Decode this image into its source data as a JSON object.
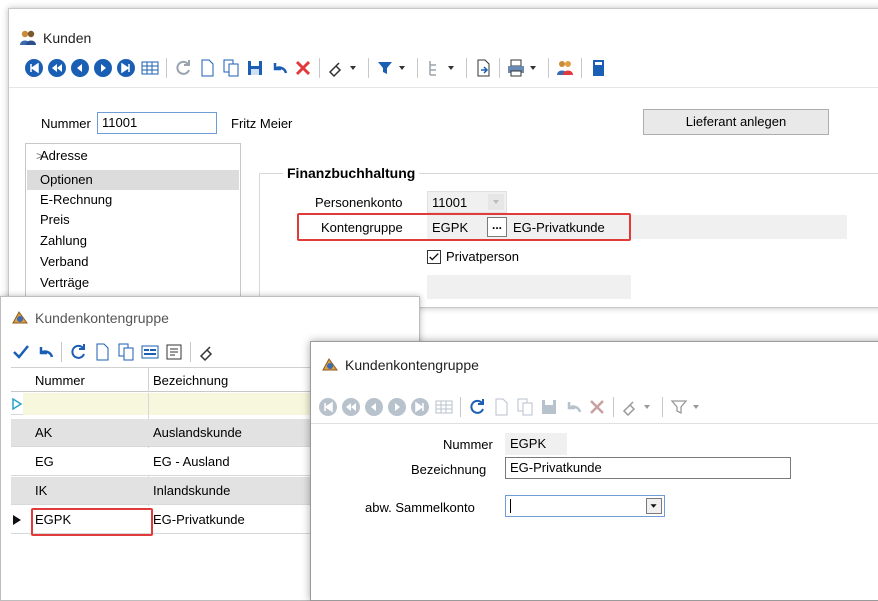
{
  "kunden": {
    "title": "Kunden",
    "nummer_label": "Nummer",
    "nummer_value": "11001",
    "name": "Fritz Meier",
    "lieferant_button": "Lieferant anlegen",
    "tree": {
      "items": [
        {
          "label": "Adresse",
          "expand": ">"
        },
        {
          "label": "Optionen"
        },
        {
          "label": "E-Rechnung"
        },
        {
          "label": "Preis"
        },
        {
          "label": "Zahlung"
        },
        {
          "label": "Verband"
        },
        {
          "label": "Verträge"
        }
      ]
    },
    "fibu": {
      "heading": "Finanzbuchhaltung",
      "personenkonto_label": "Personenkonto",
      "personenkonto_value": "11001",
      "kontengruppe_label": "Kontengruppe",
      "kontengruppe_value": "EGPK",
      "browse_label": "...",
      "kontengruppe_desc": "EG-Privatkunde",
      "privatperson_label": "Privatperson",
      "privatperson_checked": true
    }
  },
  "liste": {
    "title": "Kundenkontengruppe",
    "columns": [
      "Nummer",
      "Bezeichnung"
    ],
    "rows": [
      {
        "nummer": "AK",
        "bezeichnung": "Auslandskunde"
      },
      {
        "nummer": "EG",
        "bezeichnung": "EG - Ausland"
      },
      {
        "nummer": "IK",
        "bezeichnung": "Inlandskunde"
      },
      {
        "nummer": "EGPK",
        "bezeichnung": "EG-Privatkunde"
      }
    ]
  },
  "detail": {
    "title": "Kundenkontengruppe",
    "nummer_label": "Nummer",
    "nummer_value": "EGPK",
    "bezeichnung_label": "Bezeichnung",
    "bezeichnung_value": "EG-Privatkunde",
    "sammelkonto_label": "abw. Sammelkonto",
    "sammelkonto_value": ""
  },
  "colors": {
    "accent": "#1a5fb4",
    "highlight_red": "#e03a3a",
    "selected_bg": "#dcdcdc",
    "new_row_bg": "#f6f7dc"
  }
}
